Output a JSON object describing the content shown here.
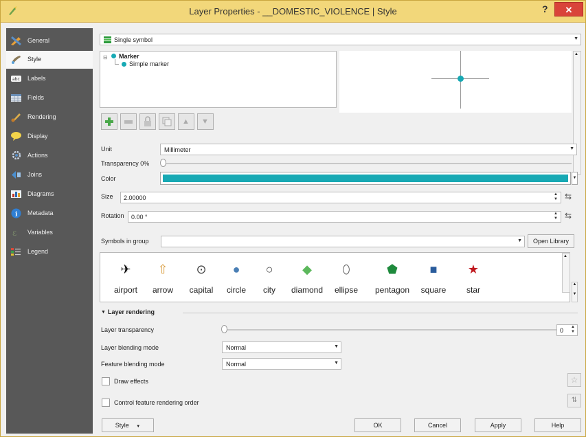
{
  "window": {
    "title": "Layer Properties - __DOMESTIC_VIOLENCE | Style",
    "help": "?",
    "close": "✕"
  },
  "sidebar": {
    "items": [
      {
        "label": "General",
        "icon": "general-icon"
      },
      {
        "label": "Style",
        "icon": "style-brush-icon"
      },
      {
        "label": "Labels",
        "icon": "labels-icon"
      },
      {
        "label": "Fields",
        "icon": "fields-table-icon"
      },
      {
        "label": "Rendering",
        "icon": "rendering-brush-icon"
      },
      {
        "label": "Display",
        "icon": "display-bubble-icon"
      },
      {
        "label": "Actions",
        "icon": "actions-gear-icon"
      },
      {
        "label": "Joins",
        "icon": "joins-icon"
      },
      {
        "label": "Diagrams",
        "icon": "diagrams-icon"
      },
      {
        "label": "Metadata",
        "icon": "metadata-info-icon"
      },
      {
        "label": "Variables",
        "icon": "variables-icon"
      },
      {
        "label": "Legend",
        "icon": "legend-icon"
      }
    ],
    "active": "Style"
  },
  "renderer": {
    "value": "Single symbol"
  },
  "tree": {
    "root": "Marker",
    "child": "Simple marker"
  },
  "unit": {
    "label": "Unit",
    "value": "Millimeter"
  },
  "transparency": {
    "label": "Transparency 0%"
  },
  "color": {
    "label": "Color",
    "value": "#17a9b4"
  },
  "size": {
    "label": "Size",
    "value": "2.00000"
  },
  "rotation": {
    "label": "Rotation",
    "value": "0.00 °"
  },
  "symbols_group": {
    "label": "Symbols in group",
    "value": "",
    "open_library": "Open Library"
  },
  "symbols": [
    {
      "name": "airport",
      "glyph": "✈",
      "color": "#111111"
    },
    {
      "name": "arrow",
      "glyph": "⇧",
      "color": "#d89a3a"
    },
    {
      "name": "capital",
      "glyph": "⊙",
      "color": "#444444"
    },
    {
      "name": "circle",
      "glyph": "●",
      "color": "#4a7fb5"
    },
    {
      "name": "city",
      "glyph": "○",
      "color": "#444444"
    },
    {
      "name": "diamond",
      "glyph": "◆",
      "color": "#5cb85c"
    },
    {
      "name": "ellipse",
      "glyph": "⬯",
      "color": "#555555"
    },
    {
      "name": "pentagon",
      "glyph": "⬟",
      "color": "#1e8a3c"
    },
    {
      "name": "square",
      "glyph": "■",
      "color": "#2a5c9c"
    },
    {
      "name": "star",
      "glyph": "★",
      "color": "#c0191f"
    }
  ],
  "layer_rendering": {
    "header": "Layer rendering",
    "transparency_label": "Layer transparency",
    "transparency_value": "0",
    "layer_blend_label": "Layer blending mode",
    "layer_blend_value": "Normal",
    "feature_blend_label": "Feature blending mode",
    "feature_blend_value": "Normal",
    "draw_effects": "Draw effects",
    "control_order": "Control feature rendering order"
  },
  "buttons": {
    "style": "Style",
    "ok": "OK",
    "cancel": "Cancel",
    "apply": "Apply",
    "help": "Help"
  }
}
